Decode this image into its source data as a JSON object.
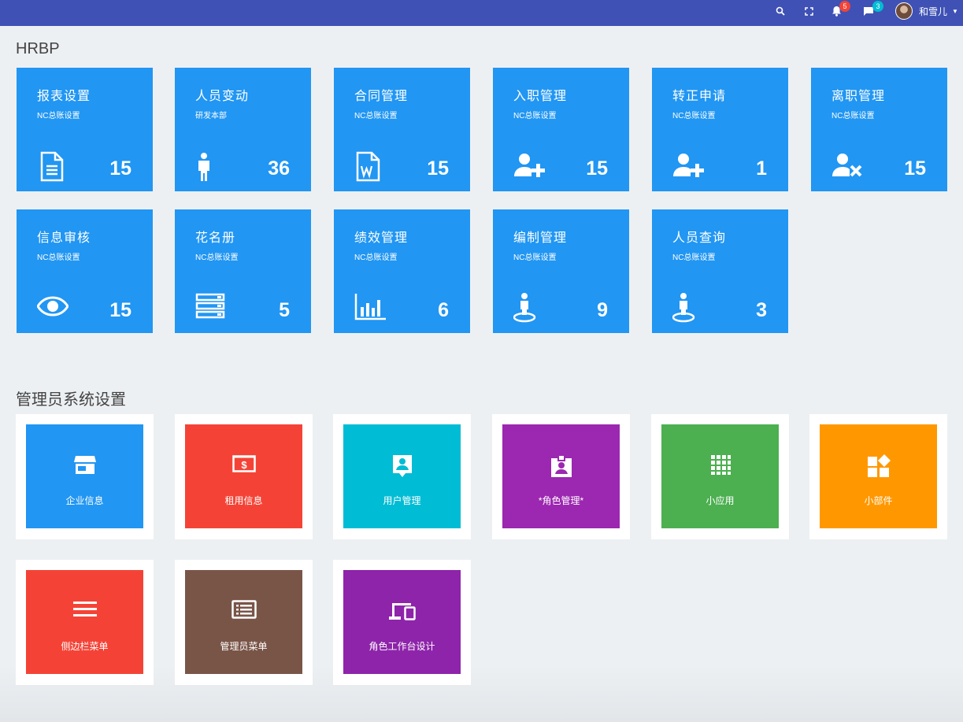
{
  "topbar": {
    "notifications_count": "5",
    "messages_count": "3",
    "user_name": "和雪儿",
    "bg_color": "#3f51b5"
  },
  "hrbp": {
    "title": "HRBP",
    "tiles": [
      {
        "title": "报表设置",
        "sub": "NC总账设置",
        "count": "15",
        "icon": "document-icon"
      },
      {
        "title": "人员变动",
        "sub": "研发本部",
        "count": "36",
        "icon": "person-icon"
      },
      {
        "title": "合同管理",
        "sub": "NC总账设置",
        "count": "15",
        "icon": "word-file-icon"
      },
      {
        "title": "入职管理",
        "sub": "NC总账设置",
        "count": "15",
        "icon": "user-add-icon"
      },
      {
        "title": "转正申请",
        "sub": "NC总账设置",
        "count": "1",
        "icon": "user-add-icon"
      },
      {
        "title": "离职管理",
        "sub": "NC总账设置",
        "count": "15",
        "icon": "user-remove-icon"
      },
      {
        "title": "信息审核",
        "sub": "NC总账设置",
        "count": "15",
        "icon": "eye-icon"
      },
      {
        "title": "花名册",
        "sub": "NC总账设置",
        "count": "5",
        "icon": "server-list-icon"
      },
      {
        "title": "绩效管理",
        "sub": "NC总账设置",
        "count": "6",
        "icon": "bar-chart-icon"
      },
      {
        "title": "编制管理",
        "sub": "NC总账设置",
        "count": "9",
        "icon": "person-pin-icon"
      },
      {
        "title": "人员查询",
        "sub": "NC总账设置",
        "count": "3",
        "icon": "person-pin-icon"
      }
    ]
  },
  "admin": {
    "title": "管理员系统设置",
    "tiles": [
      {
        "label": "企业信息",
        "color": "#2196f3",
        "icon": "store-icon"
      },
      {
        "label": "租用信息",
        "color": "#f44336",
        "icon": "money-icon"
      },
      {
        "label": "用户管理",
        "color": "#00bcd4",
        "icon": "contact-icon"
      },
      {
        "label": "*角色管理*",
        "color": "#9c27b0",
        "icon": "badge-icon"
      },
      {
        "label": "小应用",
        "color": "#4caf50",
        "icon": "apps-grid-icon"
      },
      {
        "label": "小部件",
        "color": "#ff9800",
        "icon": "widgets-icon"
      },
      {
        "label": "侧边栏菜单",
        "color": "#f44336",
        "icon": "menu-icon"
      },
      {
        "label": "管理员菜单",
        "color": "#795548",
        "icon": "list-alt-icon"
      },
      {
        "label": "角色工作台设计",
        "color": "#8e24aa",
        "icon": "devices-icon"
      }
    ]
  }
}
